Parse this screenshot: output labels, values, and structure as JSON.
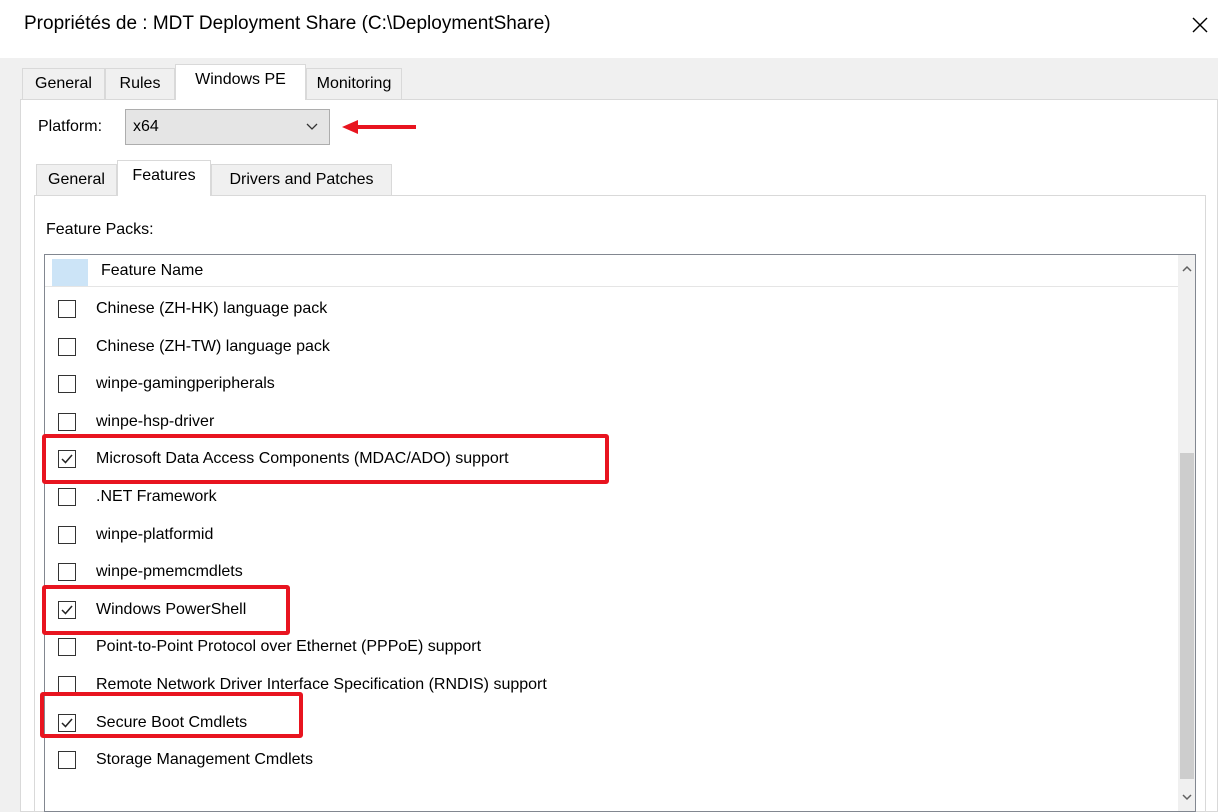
{
  "window": {
    "title": "Propriétés de : MDT Deployment Share (C:\\DeploymentShare)",
    "close_icon": "close-icon"
  },
  "main_tabs": [
    {
      "label": "General",
      "active": false
    },
    {
      "label": "Rules",
      "active": false
    },
    {
      "label": "Windows PE",
      "active": true
    },
    {
      "label": "Monitoring",
      "active": false
    }
  ],
  "platform": {
    "label": "Platform:",
    "value": "x64"
  },
  "sub_tabs": [
    {
      "label": "General",
      "active": false
    },
    {
      "label": "Features",
      "active": true
    },
    {
      "label": "Drivers and Patches",
      "active": false
    }
  ],
  "feature_packs": {
    "label": "Feature Packs:",
    "column_header": "Feature Name",
    "items": [
      {
        "name": "Chinese (ZH-HK) language pack",
        "checked": false,
        "highlighted": false
      },
      {
        "name": "Chinese (ZH-TW) language pack",
        "checked": false,
        "highlighted": false
      },
      {
        "name": "winpe-gamingperipherals",
        "checked": false,
        "highlighted": false
      },
      {
        "name": "winpe-hsp-driver",
        "checked": false,
        "highlighted": false
      },
      {
        "name": "Microsoft Data Access Components (MDAC/ADO) support",
        "checked": true,
        "highlighted": true
      },
      {
        "name": ".NET Framework",
        "checked": false,
        "highlighted": false
      },
      {
        "name": "winpe-platformid",
        "checked": false,
        "highlighted": false
      },
      {
        "name": "winpe-pmemcmdlets",
        "checked": false,
        "highlighted": false
      },
      {
        "name": "Windows PowerShell",
        "checked": true,
        "highlighted": true
      },
      {
        "name": "Point-to-Point Protocol over Ethernet (PPPoE) support",
        "checked": false,
        "highlighted": false
      },
      {
        "name": "Remote Network Driver Interface Specification (RNDIS) support",
        "checked": false,
        "highlighted": false
      },
      {
        "name": "Secure Boot Cmdlets",
        "checked": true,
        "highlighted": true
      },
      {
        "name": "Storage Management Cmdlets",
        "checked": false,
        "highlighted": false
      }
    ]
  },
  "colors": {
    "highlight": "#e8141f",
    "header_cell": "#cce4f7",
    "window_bg": "#f0f0f0"
  }
}
